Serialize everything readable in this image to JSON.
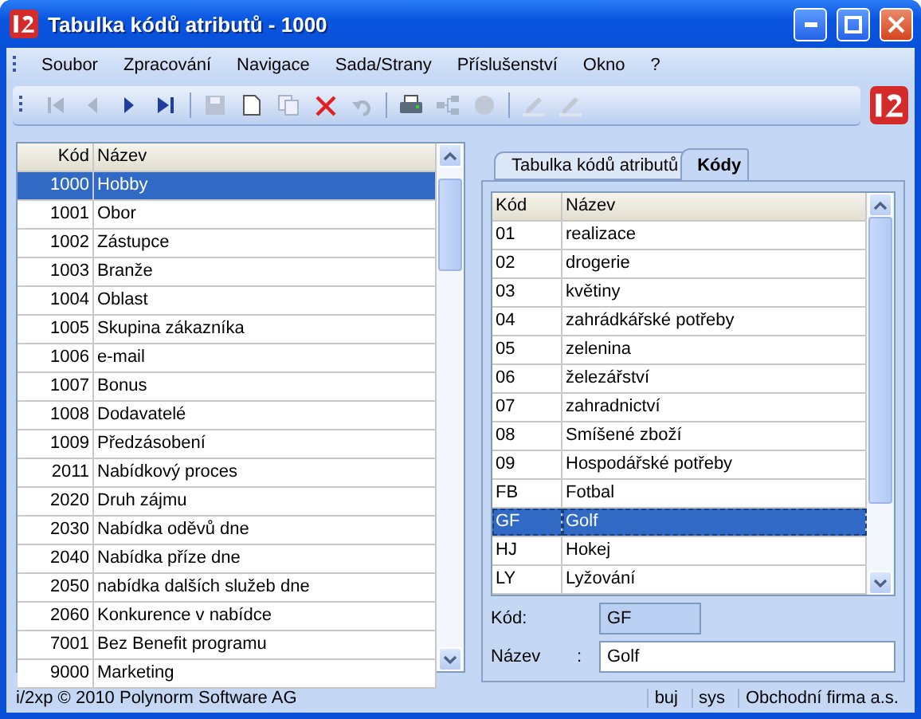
{
  "window": {
    "title": "Tabulka kódů atributů - 1000"
  },
  "menu": [
    "Soubor",
    "Zpracování",
    "Navigace",
    "Sada/Strany",
    "Příslušenství",
    "Okno",
    "?"
  ],
  "toolbar": [
    {
      "kind": "first",
      "disabled": true
    },
    {
      "kind": "prev",
      "disabled": true
    },
    {
      "kind": "next",
      "disabled": false
    },
    {
      "kind": "last",
      "disabled": false
    },
    {
      "kind": "sep"
    },
    {
      "kind": "save",
      "disabled": true
    },
    {
      "kind": "new",
      "disabled": false
    },
    {
      "kind": "copy",
      "disabled": true
    },
    {
      "kind": "delete",
      "disabled": false
    },
    {
      "kind": "undo",
      "disabled": true
    },
    {
      "kind": "sep"
    },
    {
      "kind": "print",
      "disabled": false
    },
    {
      "kind": "tree",
      "disabled": true
    },
    {
      "kind": "disc",
      "disabled": true
    },
    {
      "kind": "sep"
    },
    {
      "kind": "pen",
      "disabled": true
    },
    {
      "kind": "pen",
      "disabled": true
    }
  ],
  "left_table": {
    "columns": [
      "Kód",
      "Název"
    ],
    "rows": [
      {
        "code": "1000",
        "name": "Hobby",
        "selected": true
      },
      {
        "code": "1001",
        "name": "Obor",
        "selected": false
      },
      {
        "code": "1002",
        "name": "Zástupce",
        "selected": false
      },
      {
        "code": "1003",
        "name": "Branže",
        "selected": false
      },
      {
        "code": "1004",
        "name": "Oblast",
        "selected": false
      },
      {
        "code": "1005",
        "name": "Skupina zákazníka",
        "selected": false
      },
      {
        "code": "1006",
        "name": "e-mail",
        "selected": false
      },
      {
        "code": "1007",
        "name": "Bonus",
        "selected": false
      },
      {
        "code": "1008",
        "name": "Dodavatelé",
        "selected": false
      },
      {
        "code": "1009",
        "name": "Předzásobení",
        "selected": false
      },
      {
        "code": "2011",
        "name": "Nabídkový proces",
        "selected": false
      },
      {
        "code": "2020",
        "name": "Druh zájmu",
        "selected": false
      },
      {
        "code": "2030",
        "name": "Nabídka oděvů dne",
        "selected": false
      },
      {
        "code": "2040",
        "name": "Nabídka příze dne",
        "selected": false
      },
      {
        "code": "2050",
        "name": "nabídka dalších služeb dne",
        "selected": false
      },
      {
        "code": "2060",
        "name": "Konkurence v nabídce",
        "selected": false
      },
      {
        "code": "7001",
        "name": "Bez Benefit programu",
        "selected": false
      },
      {
        "code": "9000",
        "name": "Marketing",
        "selected": false
      }
    ]
  },
  "tabs": [
    {
      "label": "Tabulka kódů atributů",
      "selected": false
    },
    {
      "label": "Kódy",
      "selected": true
    }
  ],
  "right_table": {
    "columns": [
      "Kód",
      "Název"
    ],
    "rows": [
      {
        "code": "01",
        "name": "realizace",
        "selected": false
      },
      {
        "code": "02",
        "name": "drogerie",
        "selected": false
      },
      {
        "code": "03",
        "name": "květiny",
        "selected": false
      },
      {
        "code": "04",
        "name": "zahrádkářské potřeby",
        "selected": false
      },
      {
        "code": "05",
        "name": "zelenina",
        "selected": false
      },
      {
        "code": "06",
        "name": "železářství",
        "selected": false
      },
      {
        "code": "07",
        "name": "zahradnictví",
        "selected": false
      },
      {
        "code": "08",
        "name": "Smíšené zboží",
        "selected": false
      },
      {
        "code": "09",
        "name": "Hospodářské potřeby",
        "selected": false
      },
      {
        "code": "FB",
        "name": "Fotbal",
        "selected": false
      },
      {
        "code": "GF",
        "name": "Golf",
        "selected": true
      },
      {
        "code": "HJ",
        "name": "Hokej",
        "selected": false
      },
      {
        "code": "LY",
        "name": "Lyžování",
        "selected": false
      }
    ]
  },
  "form": {
    "code_label": "Kód:",
    "code_value": "GF",
    "name_label": "Název",
    "name_colon": ":",
    "name_value": "Golf"
  },
  "status_bar": {
    "copyright": "i/2xp © 2010 Polynorm Software AG",
    "user": "buj",
    "system": "sys",
    "company": "Obchodní firma a.s."
  }
}
